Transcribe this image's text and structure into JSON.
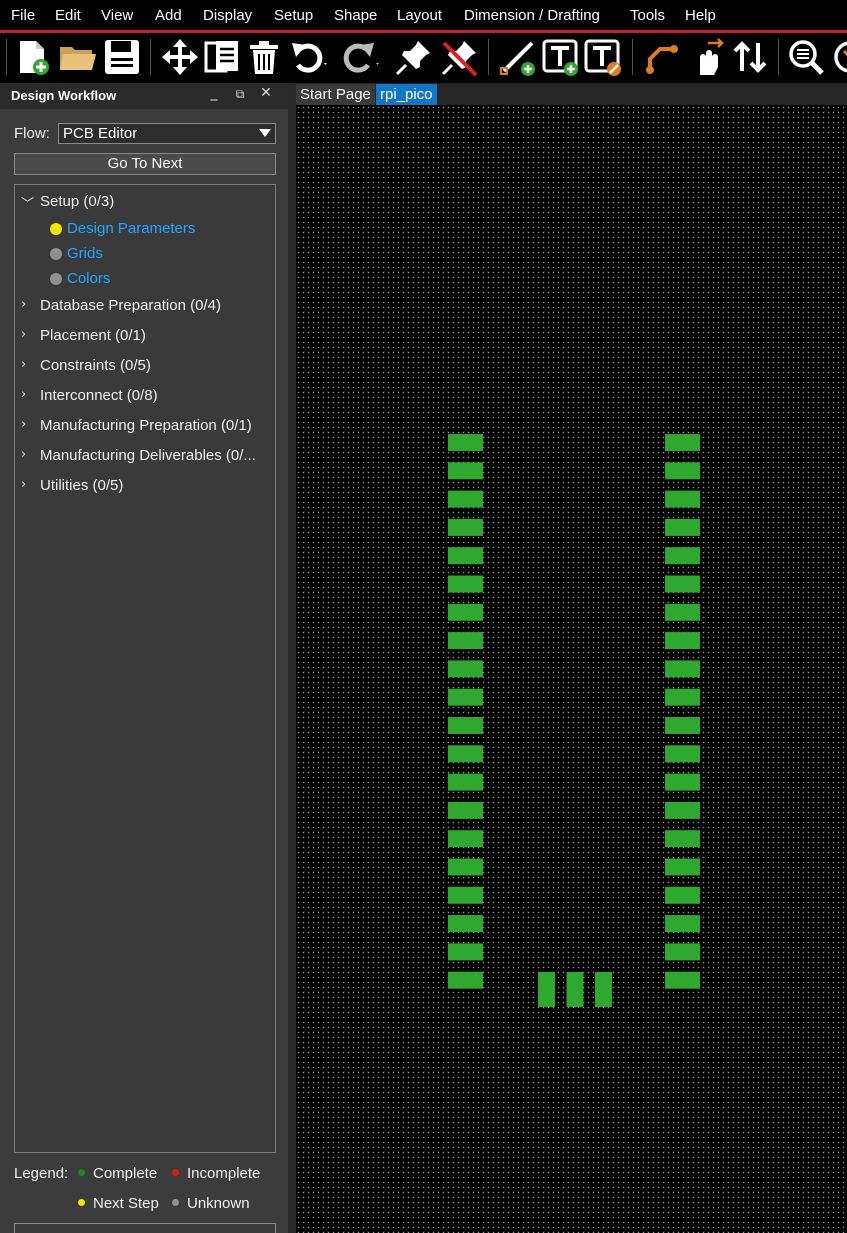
{
  "menu": [
    "File",
    "Edit",
    "View",
    "Add",
    "Display",
    "Setup",
    "Shape",
    "Layout",
    "Dimension / Drafting",
    "Tools",
    "Help"
  ],
  "toolbar": [
    "new-file-icon",
    "open-folder-icon",
    "save-icon",
    "move-icon",
    "copy-icon",
    "delete-icon",
    "undo-icon",
    "redo-icon",
    "pin-icon",
    "unpin-icon",
    "add-line-icon",
    "add-text-icon",
    "edit-text-icon",
    "add-connect-icon",
    "slide-icon",
    "swap-icon",
    "zoom-icon"
  ],
  "panel": {
    "title": "Design Workflow",
    "flow_label": "Flow:",
    "flow_value": "PCB Editor",
    "goto_next": "Go To Next",
    "tree": [
      {
        "label": "Setup  (0/3)",
        "expanded": true,
        "children": [
          {
            "label": "Design Parameters",
            "status": "next"
          },
          {
            "label": "Grids",
            "status": "unknown"
          },
          {
            "label": "Colors",
            "status": "unknown"
          }
        ]
      },
      {
        "label": "Database Preparation  (0/4)"
      },
      {
        "label": "Placement  (0/1)"
      },
      {
        "label": "Constraints  (0/5)"
      },
      {
        "label": "Interconnect  (0/8)"
      },
      {
        "label": "Manufacturing Preparation  (0/1)"
      },
      {
        "label": "Manufacturing Deliverables  (0/..."
      },
      {
        "label": "Utilities  (0/5)"
      }
    ],
    "legend_label": "Legend:",
    "legend": [
      {
        "label": "Complete",
        "color": "#1a8a1a"
      },
      {
        "label": "Incomplete",
        "color": "#e01818"
      },
      {
        "label": "Next Step",
        "color": "#f2e600"
      },
      {
        "label": "Unknown",
        "color": "#909090"
      }
    ]
  },
  "tabs": [
    {
      "label": "Start Page",
      "active": false
    },
    {
      "label": "rpi_pico",
      "active": true
    }
  ],
  "canvas": {
    "pad_color": "#2fa82f",
    "left_pad_count": 20,
    "right_pad_count": 20,
    "bottom_pad_count": 3
  }
}
